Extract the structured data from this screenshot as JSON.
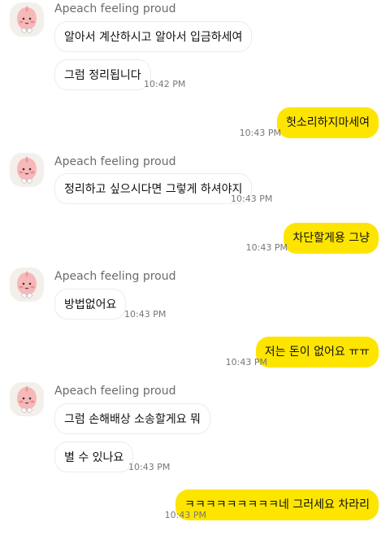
{
  "chat": {
    "sender_name": "Apeach feeling proud",
    "messages": [
      {
        "from": "other",
        "text": "알아서 계산하시고 알아서 입금하세여",
        "time": ""
      },
      {
        "from": "other",
        "text": "그럼 정리됩니다",
        "time": "10:42 PM"
      },
      {
        "from": "me",
        "text": "헛소리하지마세여",
        "time": "10:43 PM"
      },
      {
        "from": "other",
        "text": "정리하고 싶으시다면 그렇게 하셔야지",
        "time": "10:43 PM"
      },
      {
        "from": "me",
        "text": "차단할게용 그냥",
        "time": "10:43 PM"
      },
      {
        "from": "other",
        "text": "방법없어요",
        "time": "10:43 PM"
      },
      {
        "from": "me",
        "text": "저는 돈이 없어요 ㅠㅠ",
        "time": "10:43 PM"
      },
      {
        "from": "other",
        "text": "그럼 손해배상 소송할게요 뭐",
        "time": ""
      },
      {
        "from": "other",
        "text": "별 수 있나요",
        "time": "10:43 PM"
      },
      {
        "from": "me",
        "text": "ㅋㅋㅋㅋㅋㅋㅋㅋㅋ네 그러세요 차라리",
        "time": "10:43 PM"
      }
    ]
  },
  "colors": {
    "outgoing_bubble": "#fee500",
    "incoming_bubble": "#ffffff",
    "background": "#ffffff"
  },
  "icons": {
    "avatar": "apeach-avatar-icon"
  }
}
